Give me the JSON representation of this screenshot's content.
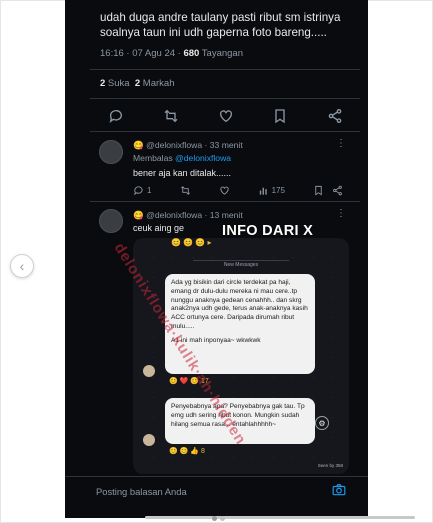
{
  "tweet": {
    "text": "udah duga andre taulany pasti ribut sm istrinya soalnya taun ini udh gaperna foto bareng.....",
    "time": "16:16 · 07 Agu 24 · ",
    "views_count": "680",
    "views_label": " Tayangan",
    "likes_count": "2",
    "likes_label": " Suka  ",
    "bookmarks_count": "2",
    "bookmarks_label": " Markah"
  },
  "reply1": {
    "emoji": "😋",
    "handle": " @delonixflowa · 33 menit",
    "replying_to_label": "Membalas ",
    "replying_to_handle": "@delonixflowa",
    "text": "bener aja kan ditalak......",
    "reply_count": "1",
    "view_count": "175"
  },
  "reply2": {
    "emoji": "😋",
    "handle": " @delonixflowa · 13 menit",
    "text": "ceuk aing ge"
  },
  "embedded_screenshot": {
    "top_reactions": "😊 😊 😊 ▸",
    "new_messages_label": "New Messages",
    "message1_line1": "Ada yg bisikin dari circle terdekat pa haji, emang dr dulu-dulu mereka ni mau cere..tp nunggu anaknya gedean cenahhh.. dan skrg anak2nya udh gede, terus anak-anaknya kasih ACC ortunya cere. Daripada dirumah ribut mulu.....",
    "message1_line2": "A1 ini mah inponyaa~ wkwkwk",
    "reactions1": "😊 ❤️ 😊 17",
    "message2": "Penyebabnya apa? Penyebabnya gak tau. Tp emg udh sering ribut konon. Mungkin sudah hilang semua rasa... entahlahhhhh~",
    "reactions2": "😊 😊 👍 8",
    "seen_label": "Seen by 358"
  },
  "overlay_caption": "INFO DARI X",
  "watermark_text": "delonixflowa·kulik·ah·hidden",
  "composer": {
    "placeholder": "Posting balasan Anda"
  },
  "colors": {
    "background": "#0a0b0e",
    "text": "#e7e9ea",
    "muted": "#8b98a5",
    "link": "#1d9bf0",
    "caption": "#ffffff",
    "watermark": "#c8283c"
  },
  "icons": [
    "chevron-left-icon",
    "reply-icon",
    "retweet-icon",
    "like-icon",
    "bookmark-icon",
    "share-icon",
    "more-icon",
    "views-icon",
    "camera-icon",
    "settings-icon"
  ]
}
